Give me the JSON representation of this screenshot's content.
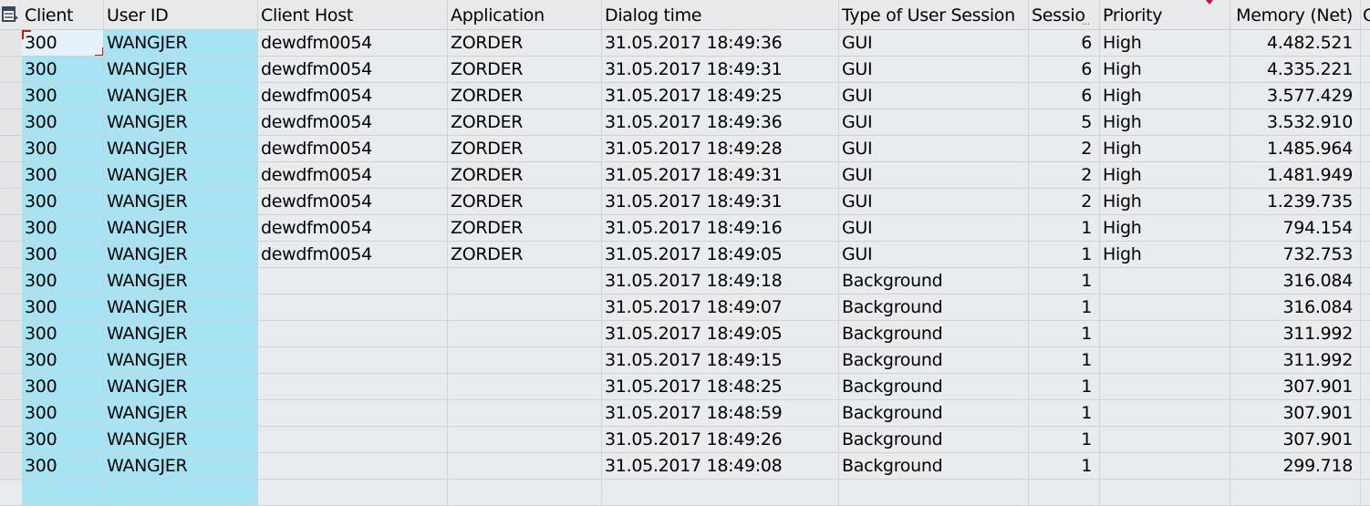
{
  "header": {
    "layout_icon": "table-layout-icon",
    "columns": [
      {
        "key": "client",
        "label": "Client"
      },
      {
        "key": "user_id",
        "label": "User ID"
      },
      {
        "key": "client_host",
        "label": "Client Host"
      },
      {
        "key": "application",
        "label": "Application"
      },
      {
        "key": "dialog_time",
        "label": "Dialog time"
      },
      {
        "key": "session_type",
        "label": "Type of User Session"
      },
      {
        "key": "session",
        "label": "Sessio"
      },
      {
        "key": "priority",
        "label": "Priority"
      },
      {
        "key": "memory_net",
        "label": "Memory (Net)"
      },
      {
        "key": "next",
        "label": "C"
      }
    ],
    "sorted_column": "memory_net",
    "sort_direction": "descending"
  },
  "colors": {
    "key_column_bg": "#a6e4f3",
    "cell_bg": "#e9ecef",
    "selection_marker": "#d01010",
    "sort_marker": "#c0143c"
  },
  "selected_cell": {
    "row": 0,
    "column": "client"
  },
  "rows": [
    {
      "client": "300",
      "user_id": "WANGJER",
      "client_host": "dewdfm0054",
      "application": "ZORDER",
      "dialog_time": "31.05.2017 18:49:36",
      "session_type": "GUI",
      "session": "6",
      "priority": "High",
      "memory_net": "4.482.521"
    },
    {
      "client": "300",
      "user_id": "WANGJER",
      "client_host": "dewdfm0054",
      "application": "ZORDER",
      "dialog_time": "31.05.2017 18:49:31",
      "session_type": "GUI",
      "session": "6",
      "priority": "High",
      "memory_net": "4.335.221"
    },
    {
      "client": "300",
      "user_id": "WANGJER",
      "client_host": "dewdfm0054",
      "application": "ZORDER",
      "dialog_time": "31.05.2017 18:49:25",
      "session_type": "GUI",
      "session": "6",
      "priority": "High",
      "memory_net": "3.577.429"
    },
    {
      "client": "300",
      "user_id": "WANGJER",
      "client_host": "dewdfm0054",
      "application": "ZORDER",
      "dialog_time": "31.05.2017 18:49:36",
      "session_type": "GUI",
      "session": "5",
      "priority": "High",
      "memory_net": "3.532.910"
    },
    {
      "client": "300",
      "user_id": "WANGJER",
      "client_host": "dewdfm0054",
      "application": "ZORDER",
      "dialog_time": "31.05.2017 18:49:28",
      "session_type": "GUI",
      "session": "2",
      "priority": "High",
      "memory_net": "1.485.964"
    },
    {
      "client": "300",
      "user_id": "WANGJER",
      "client_host": "dewdfm0054",
      "application": "ZORDER",
      "dialog_time": "31.05.2017 18:49:31",
      "session_type": "GUI",
      "session": "2",
      "priority": "High",
      "memory_net": "1.481.949"
    },
    {
      "client": "300",
      "user_id": "WANGJER",
      "client_host": "dewdfm0054",
      "application": "ZORDER",
      "dialog_time": "31.05.2017 18:49:31",
      "session_type": "GUI",
      "session": "2",
      "priority": "High",
      "memory_net": "1.239.735"
    },
    {
      "client": "300",
      "user_id": "WANGJER",
      "client_host": "dewdfm0054",
      "application": "ZORDER",
      "dialog_time": "31.05.2017 18:49:16",
      "session_type": "GUI",
      "session": "1",
      "priority": "High",
      "memory_net": "794.154"
    },
    {
      "client": "300",
      "user_id": "WANGJER",
      "client_host": "dewdfm0054",
      "application": "ZORDER",
      "dialog_time": "31.05.2017 18:49:05",
      "session_type": "GUI",
      "session": "1",
      "priority": "High",
      "memory_net": "732.753"
    },
    {
      "client": "300",
      "user_id": "WANGJER",
      "client_host": "",
      "application": "",
      "dialog_time": "31.05.2017 18:49:18",
      "session_type": "Background",
      "session": "1",
      "priority": "",
      "memory_net": "316.084"
    },
    {
      "client": "300",
      "user_id": "WANGJER",
      "client_host": "",
      "application": "",
      "dialog_time": "31.05.2017 18:49:07",
      "session_type": "Background",
      "session": "1",
      "priority": "",
      "memory_net": "316.084"
    },
    {
      "client": "300",
      "user_id": "WANGJER",
      "client_host": "",
      "application": "",
      "dialog_time": "31.05.2017 18:49:05",
      "session_type": "Background",
      "session": "1",
      "priority": "",
      "memory_net": "311.992"
    },
    {
      "client": "300",
      "user_id": "WANGJER",
      "client_host": "",
      "application": "",
      "dialog_time": "31.05.2017 18:49:15",
      "session_type": "Background",
      "session": "1",
      "priority": "",
      "memory_net": "311.992"
    },
    {
      "client": "300",
      "user_id": "WANGJER",
      "client_host": "",
      "application": "",
      "dialog_time": "31.05.2017 18:48:25",
      "session_type": "Background",
      "session": "1",
      "priority": "",
      "memory_net": "307.901"
    },
    {
      "client": "300",
      "user_id": "WANGJER",
      "client_host": "",
      "application": "",
      "dialog_time": "31.05.2017 18:48:59",
      "session_type": "Background",
      "session": "1",
      "priority": "",
      "memory_net": "307.901"
    },
    {
      "client": "300",
      "user_id": "WANGJER",
      "client_host": "",
      "application": "",
      "dialog_time": "31.05.2017 18:49:26",
      "session_type": "Background",
      "session": "1",
      "priority": "",
      "memory_net": "307.901"
    },
    {
      "client": "300",
      "user_id": "WANGJER",
      "client_host": "",
      "application": "",
      "dialog_time": "31.05.2017 18:49:08",
      "session_type": "Background",
      "session": "1",
      "priority": "",
      "memory_net": "299.718"
    },
    {
      "client": "",
      "user_id": "",
      "client_host": "",
      "application": "",
      "dialog_time": "",
      "session_type": "",
      "session": "",
      "priority": "",
      "memory_net": ""
    }
  ]
}
